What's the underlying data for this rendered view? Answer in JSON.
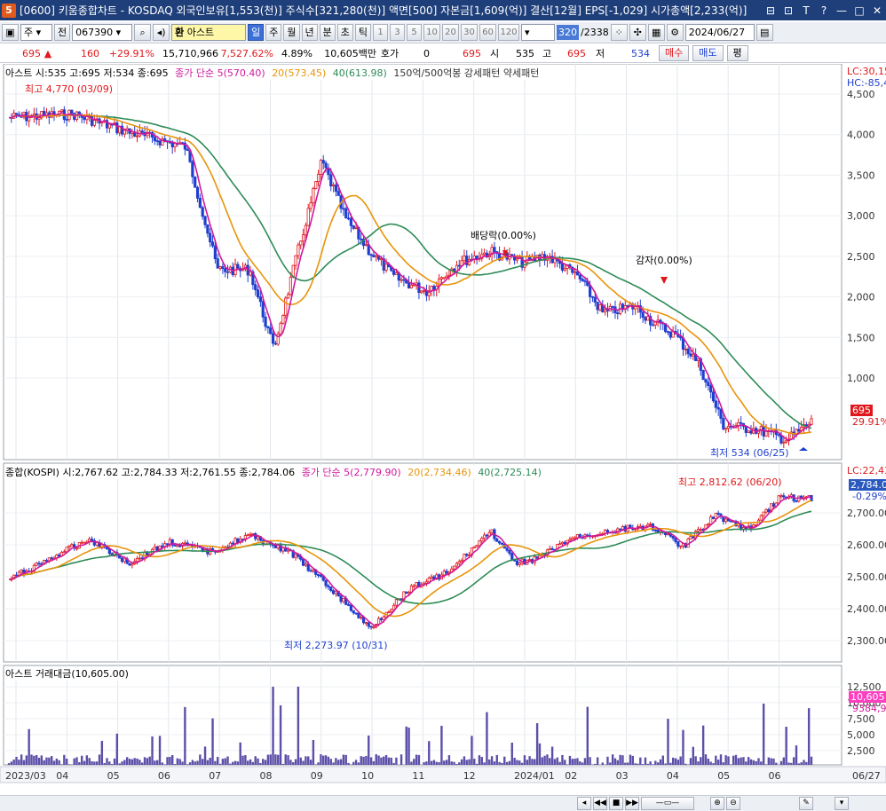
{
  "window": {
    "icon_text": "5",
    "title": "[0600] 키움종합차트 - KOSDAQ 외국인보유[1,553(천)] 주식수[321,280(천)] 액면[500] 자본금[1,609(억)] 결산[12월] EPS[-1,029] 시가총액[2,233(억)]",
    "controls": [
      "⊟",
      "⊡",
      "T",
      "?",
      "—",
      "□",
      "✕"
    ]
  },
  "toolbar": {
    "period_select": "주",
    "prev_label": "전",
    "code_value": "067390",
    "stock_name_prefix": "환",
    "stock_name": "아스트",
    "timeframes": [
      "일",
      "주",
      "월",
      "년",
      "분",
      "초",
      "틱"
    ],
    "active_timeframe": "일",
    "intervals": [
      "1",
      "3",
      "5",
      "10",
      "20",
      "30",
      "60",
      "120"
    ],
    "count_value": "320",
    "count_total": "/2338",
    "date_value": "2024/06/27"
  },
  "quote": {
    "price": "695",
    "arrow": "▲",
    "change": "160",
    "change_pct": "+29.91%",
    "volume": "15,710,966",
    "volume_pct": "7,527.62%",
    "turnover_pct": "4.89%",
    "trade_value": "10,605백만",
    "hoga_label": "호가",
    "hoga_value": "0",
    "hoga_price": "695",
    "open_label": "시",
    "open": "535",
    "high_label": "고",
    "high": "695",
    "low_label": "저",
    "low": "534",
    "buy_button": "매수",
    "sell_button": "매도",
    "eval_button": "평"
  },
  "panels": {
    "price": {
      "legend_main": "아스트 시:535 고:695 저:534 종:695",
      "legend_ma": "종가 단순 5(570.40)",
      "legend_ma20": "20(573.45)",
      "legend_ma40": "40(613.98)",
      "legend_pattern": "150억/500억봉 강세패턴   약세패턴",
      "annot_high": "최고 4,770 (03/09)",
      "annot_low": "최저 534 (06/25)",
      "annot_dividend": "배당락(0.00%)",
      "annot_reduction": "감자(0.00%)",
      "lc_label": "LC:30,15",
      "hc_label": "HC:-85,4",
      "price_tag": "695",
      "pct_tag": "29.91%",
      "y_ticks": [
        "4,500",
        "4,000",
        "3,500",
        "3,000",
        "2,500",
        "2,000",
        "1,500",
        "1,000"
      ]
    },
    "kospi": {
      "legend_main": "종합(KOSPI) 시:2,767.62 고:2,784.33 저:2,761.55 종:2,784.06",
      "legend_ma": "종가 단순 5(2,779.90)",
      "legend_ma20": "20(2,734.46)",
      "legend_ma40": "40(2,725.14)",
      "annot_high": "최고 2,812.62 (06/20)",
      "annot_low": "최저 2,273.97 (10/31)",
      "lc_label": "LC:22,43",
      "price_tag": "2,784.0",
      "pct_tag": "-0.29%",
      "y_ticks": [
        "2,700.00",
        "2,600.00",
        "2,500.00",
        "2,400.00",
        "2,300.00"
      ]
    },
    "volume": {
      "legend_main": "아스트 거래대금(10,605.00)",
      "tag_value": "10,605",
      "tag_avg": "9384,96",
      "y_ticks": [
        "12,500",
        "10,000",
        "7,500",
        "5,000",
        "2,500"
      ]
    }
  },
  "x_axis": {
    "labels": [
      "2023/03",
      "04",
      "05",
      "06",
      "07",
      "08",
      "09",
      "10",
      "11",
      "12",
      "2024/01",
      "02",
      "03",
      "04",
      "05",
      "06"
    ],
    "right_label": "06/27"
  },
  "colors": {
    "up": "#e0171b",
    "down": "#1f3fd0",
    "ma5": "#d0199a",
    "ma20": "#e8940a",
    "ma40": "#2e8b57",
    "volume_bar": "#5b4fa8",
    "title_bar": "#1f3f7a"
  }
}
